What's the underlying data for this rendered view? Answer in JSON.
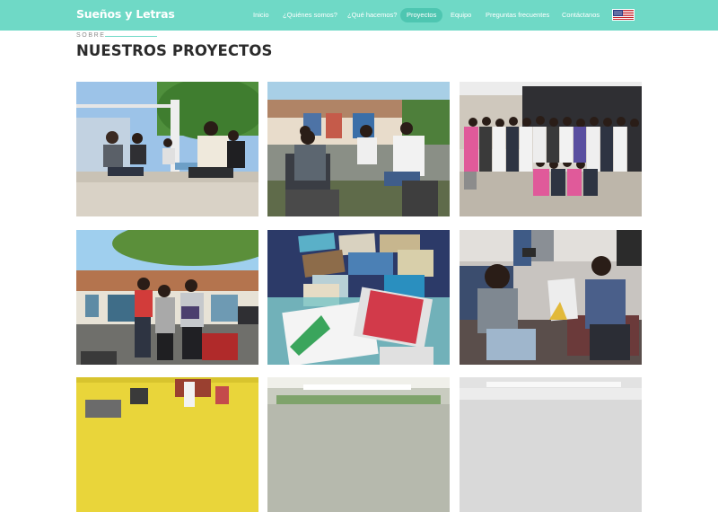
{
  "brand": {
    "name": "Sueños y Letras"
  },
  "nav": {
    "items": [
      {
        "label": "Inicio"
      },
      {
        "label": "¿Quiénes somos?"
      },
      {
        "label": "¿Qué hacemos?"
      },
      {
        "label": "Proyectos",
        "active": true
      },
      {
        "label": "Equipo"
      },
      {
        "label": "Preguntas frecuentes"
      },
      {
        "label": "Contáctanos"
      }
    ],
    "language_flag": "us-flag-icon"
  },
  "section": {
    "eyebrow": "SOBRE",
    "title": "NUESTROS PROYECTOS"
  },
  "projects": [
    {
      "id": "p1",
      "subject": "students sitting on porch"
    },
    {
      "id": "p2",
      "subject": "children writing outdoors"
    },
    {
      "id": "p3",
      "subject": "group photo in room"
    },
    {
      "id": "p4",
      "subject": "children holding book in street"
    },
    {
      "id": "p5",
      "subject": "books on table"
    },
    {
      "id": "p6",
      "subject": "two people sitting talking"
    },
    {
      "id": "p7",
      "subject": "yellow room"
    },
    {
      "id": "p8",
      "subject": "classroom ceiling"
    },
    {
      "id": "p9",
      "subject": "bright room"
    }
  ],
  "colors": {
    "brand": "#6fd9c6",
    "active_pill": "#4ec6b1",
    "heading": "#2b2b2b",
    "eyebrow": "#8a8a8a"
  }
}
